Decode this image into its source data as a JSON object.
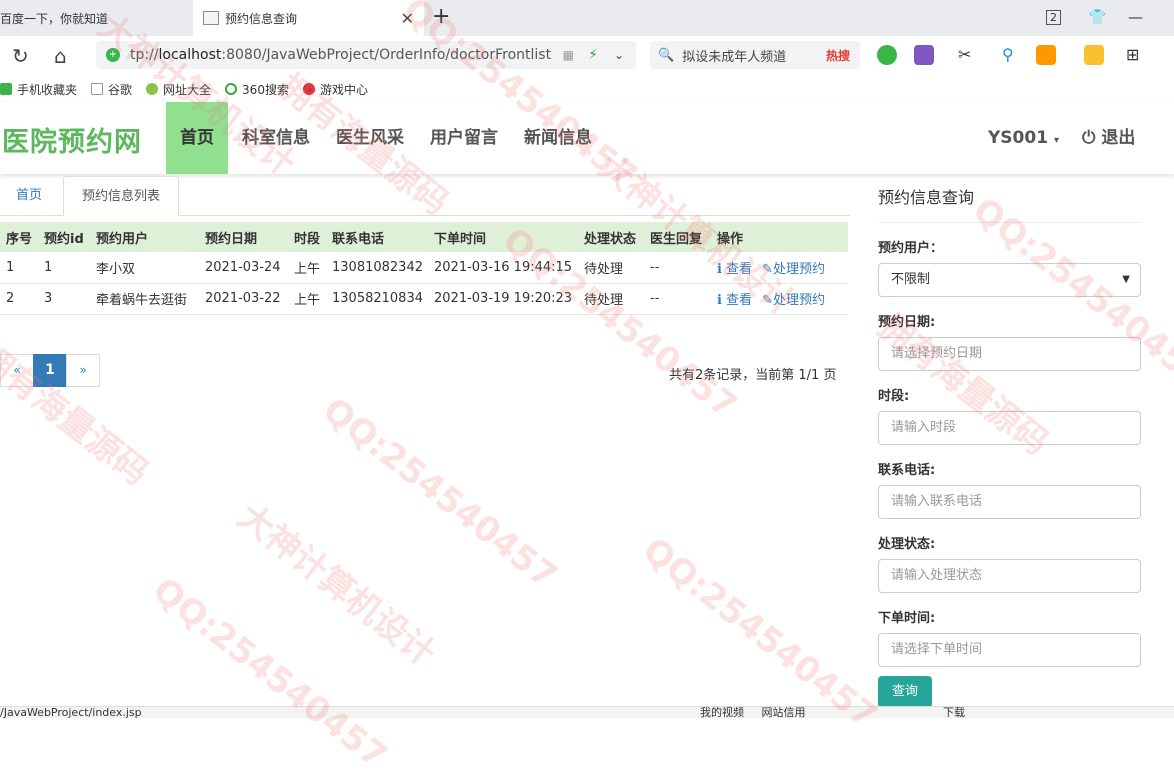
{
  "browser": {
    "inactive_tab": "百度一下，你就知道",
    "active_tab": "预约信息查询",
    "tab_count": "2",
    "url_prefix": "tp://",
    "url_host": "localhost",
    "url_rest": ":8080/JavaWebProject/OrderInfo/doctorFrontlist",
    "search_text": "拟设未成年人频道",
    "search_hot": "热搜",
    "bookmarks": [
      "手机收藏夹",
      "谷歌",
      "网址大全",
      "360搜索",
      "游戏中心"
    ]
  },
  "site": {
    "brand": "医院预约网",
    "nav": [
      "首页",
      "科室信息",
      "医生风采",
      "用户留言",
      "新闻信息"
    ],
    "user": "YS001",
    "logout": "退出"
  },
  "tabs": {
    "home": "首页",
    "list": "预约信息列表"
  },
  "table": {
    "headers": [
      "序号",
      "预约id",
      "预约用户",
      "预约日期",
      "时段",
      "联系电话",
      "下单时间",
      "处理状态",
      "医生回复",
      "操作"
    ],
    "rows": [
      {
        "no": "1",
        "id": "1",
        "user": "李小双",
        "date": "2021-03-24",
        "slot": "上午",
        "phone": "13081082342",
        "time": "2021-03-16 19:44:15",
        "state": "待处理",
        "reply": "--",
        "view": "查看",
        "handle": "处理预约"
      },
      {
        "no": "2",
        "id": "3",
        "user": "牵着蜗牛去逛街",
        "date": "2021-03-22",
        "slot": "上午",
        "phone": "13058210834",
        "time": "2021-03-19 19:20:23",
        "state": "待处理",
        "reply": "--",
        "view": "查看",
        "handle": "处理预约"
      }
    ]
  },
  "pager": {
    "prev": "«",
    "current": "1",
    "next": "»",
    "info": "共有2条记录，当前第 1/1 页"
  },
  "query": {
    "title": "预约信息查询",
    "user_label": "预约用户：",
    "user_value": "不限制",
    "date_label": "预约日期:",
    "date_ph": "请选择预约日期",
    "slot_label": "时段:",
    "slot_ph": "请输入时段",
    "phone_label": "联系电话:",
    "phone_ph": "请输入联系电话",
    "state_label": "处理状态:",
    "state_ph": "请输入处理状态",
    "time_label": "下单时间:",
    "time_ph": "请选择下单时间",
    "submit": "查询"
  },
  "status": {
    "link": "/JavaWebProject/index.jsp",
    "items": [
      "我的视频",
      "网站信用",
      "下载"
    ]
  },
  "watermark": [
    "大神计算机设计",
    "QQ:254540457",
    "拥有海量源码"
  ],
  "colors": {
    "brand": "#5cb85c",
    "nav_active": "#90e090",
    "table_head": "#dff0d8",
    "link": "#337ab7",
    "button": "#26a69a"
  }
}
